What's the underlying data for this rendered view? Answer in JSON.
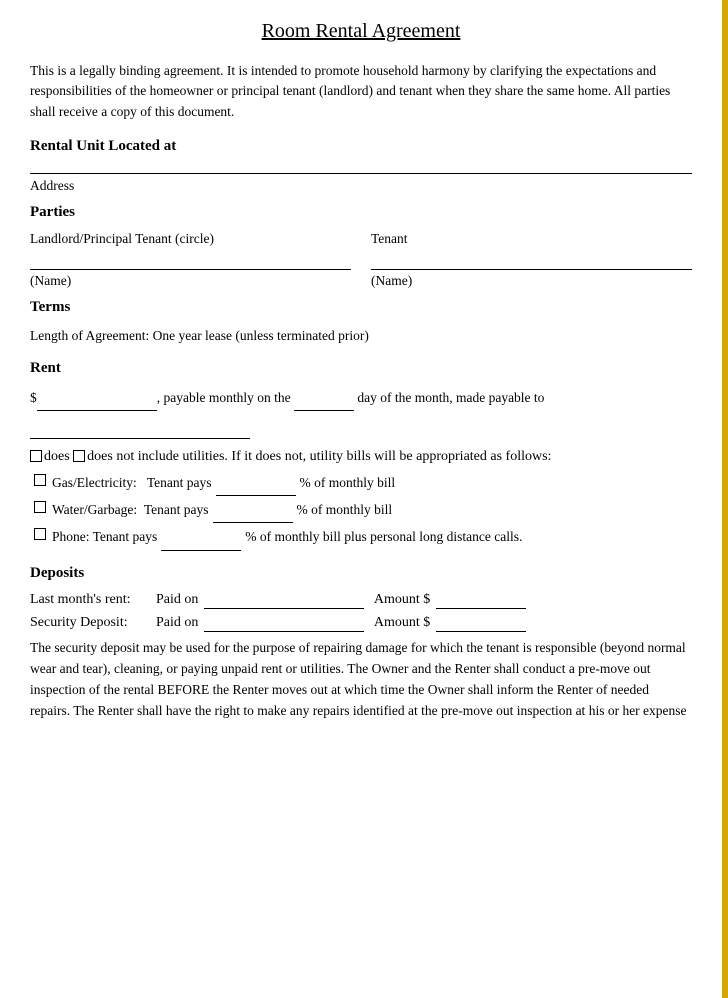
{
  "document": {
    "title": "Room Rental Agreement",
    "intro": "This is a legally binding agreement. It is intended to promote household harmony by clarifying the expectations and responsibilities of the homeowner or principal tenant (landlord) and tenant when they share the same home. All parties shall receive a copy of this document.",
    "sections": {
      "rental_unit": {
        "heading": "Rental Unit Located at",
        "field_label": "Address"
      },
      "parties": {
        "heading": "Parties",
        "landlord_label": "Landlord/Principal Tenant (circle)",
        "tenant_label": "Tenant",
        "name_label": "(Name)"
      },
      "terms": {
        "heading": "Terms",
        "length_text": "Length of Agreement: One year lease (unless terminated prior)"
      },
      "rent": {
        "heading": "Rent",
        "rent_line": ", payable monthly on the",
        "rent_line2": "day of the month, made payable to",
        "dollar_prefix": "$",
        "utilities_text": "Rent □does □does not include utilities. If it does not, utility bills will be appropriated as follows:",
        "utilities": [
          {
            "icon": "□",
            "label": "Gas/Electricity:",
            "text": "Tenant pays",
            "suffix": "% of monthly bill"
          },
          {
            "icon": "□",
            "label": "Water/Garbage:",
            "text": "Tenant pays",
            "suffix": "% of monthly bill"
          },
          {
            "icon": "□",
            "label": "Phone: Tenant pays",
            "text": "",
            "suffix": "% of monthly bill plus personal long distance calls."
          }
        ]
      },
      "deposits": {
        "heading": "Deposits",
        "rows": [
          {
            "label": "Last month’s rent:",
            "paid_on": "Paid on",
            "amount_prefix": "Amount $"
          },
          {
            "label": "Security Deposit:",
            "paid_on": "Paid on",
            "amount_prefix": "Amount $"
          }
        ],
        "security_text": "The security deposit may be used for the purpose of repairing damage for which the tenant is responsible (beyond normal wear and tear), cleaning, or paying unpaid rent or utilities. The Owner and the Renter shall conduct a pre-move out inspection of the rental BEFORE the Renter moves out at which time the Owner shall inform the Renter of needed repairs. The Renter shall have the right to make any repairs identified at the pre-move out inspection at his or her expense"
      }
    }
  }
}
